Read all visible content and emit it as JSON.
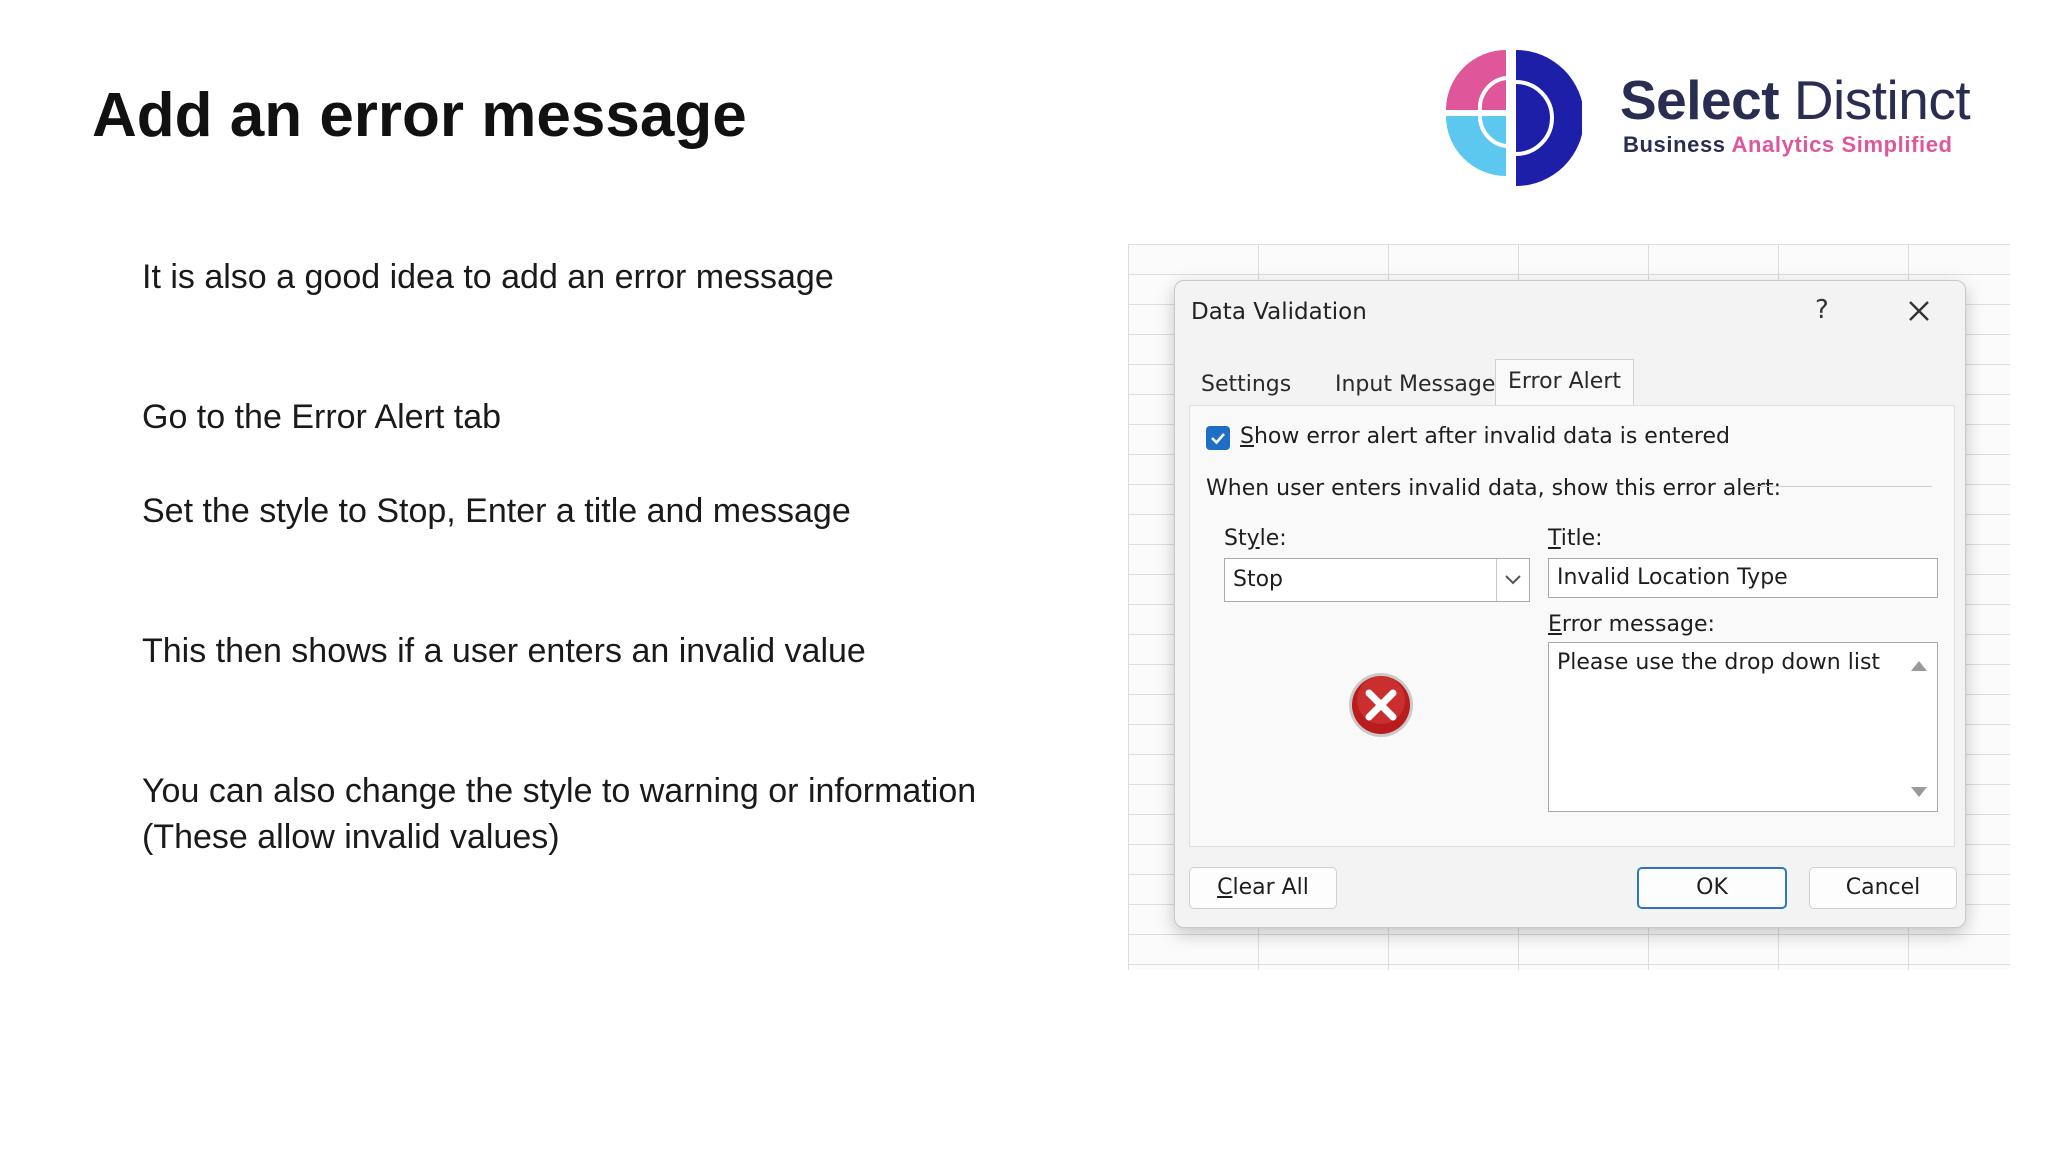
{
  "slide": {
    "title": "Add an error message",
    "bullets": [
      "It is also a good idea to add an error message",
      "Go to the Error Alert tab",
      "Set the style to Stop, Enter a title and message",
      "This then shows if a user enters an invalid value",
      "You can also change the style to warning or information",
      "(These allow invalid values)"
    ]
  },
  "logo": {
    "name_bold": "Select",
    "name_regular": "Distinct",
    "tagline_1": "Business",
    "tagline_2": "Analytics Simplified",
    "colors": {
      "navy": "#2a2d52",
      "pink": "#e0569a",
      "cyan": "#5cc8f0",
      "blue": "#1e1fa8"
    }
  },
  "dialog": {
    "title": "Data Validation",
    "help_label": "?",
    "tabs": [
      "Settings",
      "Input Message",
      "Error Alert"
    ],
    "active_tab": "Error Alert",
    "show_alert_checkbox": {
      "checked": true,
      "label_underlined": "S",
      "label_rest": "how error alert after invalid data is entered"
    },
    "section_label": "When user enters invalid data, show this error alert:",
    "style": {
      "label_pre": "St",
      "label_u": "y",
      "label_post": "le:",
      "value": "Stop"
    },
    "title_field": {
      "label_u": "T",
      "label_rest": "itle:",
      "value": "Invalid Location Type"
    },
    "message_field": {
      "label_u": "E",
      "label_rest": "rror message:",
      "value": "Please use the drop down list"
    },
    "icon": "error-stop-icon",
    "buttons": {
      "clear_u": "C",
      "clear_rest": "lear All",
      "ok": "OK",
      "cancel": "Cancel"
    },
    "accent_color": "#1f6ec6"
  }
}
